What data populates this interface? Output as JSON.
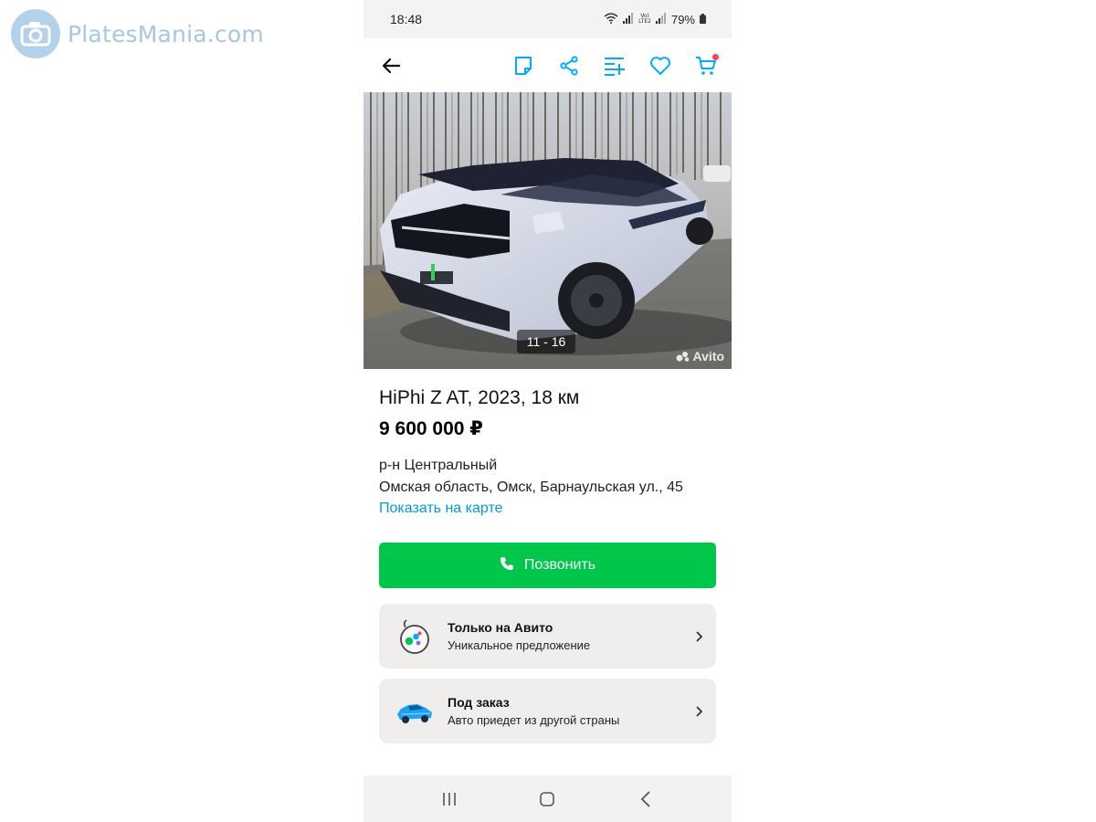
{
  "watermark": {
    "text_a": "Plates",
    "text_b": "Mania",
    "text_c": ".com"
  },
  "status": {
    "time": "18:48",
    "battery": "79%",
    "net_top": "Vo)",
    "net_bottom": "LTE2"
  },
  "toolbar": {
    "icons": [
      "back-arrow-icon",
      "note-icon",
      "share-icon",
      "compare-icon",
      "heart-icon",
      "cart-icon"
    ]
  },
  "photo": {
    "counter": "11 - 16",
    "watermark": "Avito"
  },
  "listing": {
    "title": "HiPhi Z AT, 2023, 18 км",
    "price": "9 600 000 ₽",
    "district": "р-н Центральный",
    "address": "Омская область, Омск, Барнаульская ул., 45",
    "map_link": "Показать на карте"
  },
  "call_button": {
    "label": "Позвонить"
  },
  "cards": [
    {
      "title": "Только на Авито",
      "subtitle": "Уникальное предложение",
      "icon": "avito-bubble-icon"
    },
    {
      "title": "Под заказ",
      "subtitle": "Авто приедет из другой страны",
      "icon": "car-icon"
    }
  ],
  "colors": {
    "accent": "#00c74c",
    "link": "#0099e5",
    "card_bg": "#f0eeed",
    "icon_blue": "#00aaff"
  }
}
